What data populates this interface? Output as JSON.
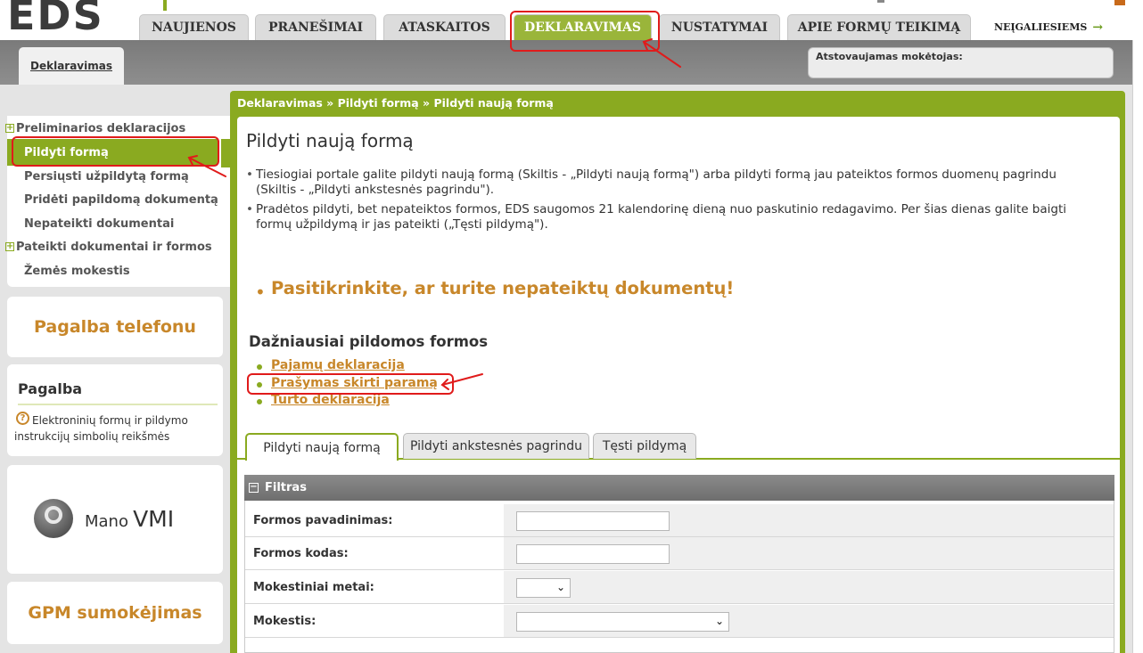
{
  "header": {
    "logo_text": "EDS",
    "tabs": [
      {
        "label": "NAUJIENOS"
      },
      {
        "label": "PRANEŠIMAI"
      },
      {
        "label": "ATASKAITOS"
      },
      {
        "label": "DEKLARAVIMAS"
      },
      {
        "label": "NUSTATYMAI"
      },
      {
        "label": "APIE FORMŲ TEIKIMĄ"
      }
    ],
    "accessibility_link": "NEĮGALIESIEMS",
    "accessibility_arrow": "→"
  },
  "subbar": {
    "active_tab": "Deklaravimas",
    "payer_label": "Atstovaujamas mokėtojas:"
  },
  "sidebar": {
    "items": [
      {
        "label": "Preliminarios deklaracijos",
        "expandable": true
      },
      {
        "label": "Pildyti formą",
        "active": true
      },
      {
        "label": "Persiųsti užpildytą formą"
      },
      {
        "label": "Pridėti papildomą dokumentą"
      },
      {
        "label": "Nepateikti dokumentai"
      },
      {
        "label": "Pateikti dokumentai ir formos",
        "expandable": true
      },
      {
        "label": "Žemės mokestis"
      }
    ],
    "phone_help": "Pagalba telefonu",
    "help_title": "Pagalba",
    "help_icon": "?",
    "help_text": "Elektroninių formų ir pildymo instrukcijų simbolių reikšmės",
    "mano_vmi_small": "Mano",
    "mano_vmi_big": "VMI",
    "gpm": "GPM sumokėjimas"
  },
  "main": {
    "breadcrumb": "Deklaravimas » Pildyti formą » Pildyti naują formą",
    "title": "Pildyti naują formą",
    "bullets": [
      "Tiesiogiai portale galite pildyti naują formą (Skiltis - „Pildyti naują formą\") arba pildyti formą jau pateiktos formos duomenų pagrindu (Skiltis - „Pildyti ankstesnės pagrindu\").",
      "Pradėtos pildyti, bet nepateiktos formos, EDS saugomos 21 kalendorinę dieną nuo paskutinio redagavimo. Per šias dienas galite baigti formų užpildymą ir jas pateikti („Tęsti pildymą\")."
    ],
    "warning": "Pasitikrinkite, ar turite nepateiktų dokumentų!",
    "frequent_title": "Dažniausiai pildomos formos",
    "frequent_forms": [
      "Pajamų deklaracija",
      "Prašymas skirti paramą",
      "Turto deklaracija"
    ],
    "tabs": [
      {
        "label": "Pildyti naują formą",
        "active": true
      },
      {
        "label": "Pildyti ankstesnės pagrindu"
      },
      {
        "label": "Tęsti pildymą"
      }
    ]
  },
  "filter": {
    "title": "Filtras",
    "rows": [
      {
        "label": "Formos pavadinimas:",
        "type": "text",
        "value": ""
      },
      {
        "label": "Formos kodas:",
        "type": "text",
        "value": ""
      },
      {
        "label": "Mokestiniai metai:",
        "type": "select",
        "value": ""
      },
      {
        "label": "Mokestis:",
        "type": "select",
        "value": ""
      }
    ]
  },
  "colors": {
    "brand_green": "#8aaa20",
    "accent_orange": "#c8872a",
    "annotation_red": "#e01b1b"
  }
}
